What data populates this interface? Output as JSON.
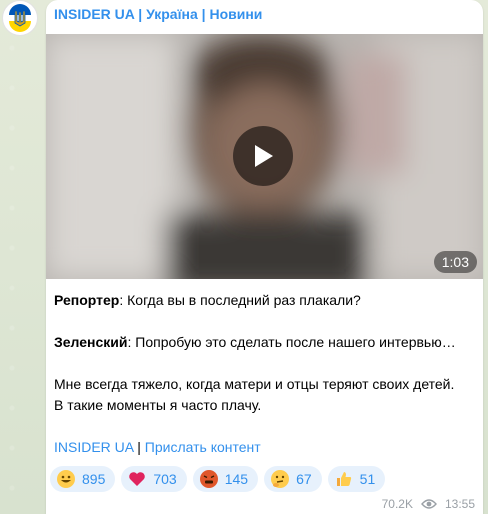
{
  "channel": {
    "name": "INSIDER UA | Україна | Новини",
    "avatar_icon": "ukraine-trident-icon"
  },
  "video": {
    "duration": "1:03",
    "play_icon": "play-icon"
  },
  "message": {
    "line1_label": "Репортер",
    "line1_text": ": Когда вы в последний раз плакали?",
    "line2_label": "Зеленский",
    "line2_text": ": Попробую это сделать после нашего интервью…",
    "line3": "Мне всегда тяжело, когда матери и отцы теряют своих детей.",
    "line4": "В такие моменты я часто плачу.",
    "link1": "INSIDER UA",
    "separator": " | ",
    "link2": "Прислать контент"
  },
  "reactions": [
    {
      "icon": "grinning-face-icon",
      "count": "895"
    },
    {
      "icon": "red-heart-icon",
      "count": "703"
    },
    {
      "icon": "angry-face-icon",
      "count": "145"
    },
    {
      "icon": "thinking-face-icon",
      "count": "67"
    },
    {
      "icon": "thumbs-up-icon",
      "count": "51"
    }
  ],
  "meta": {
    "views": "70.2K",
    "views_icon": "eye-icon",
    "time": "13:55"
  },
  "colors": {
    "accent": "#3390ec",
    "background": "#dfe7d6",
    "reaction_bg": "#e7f1fc"
  }
}
